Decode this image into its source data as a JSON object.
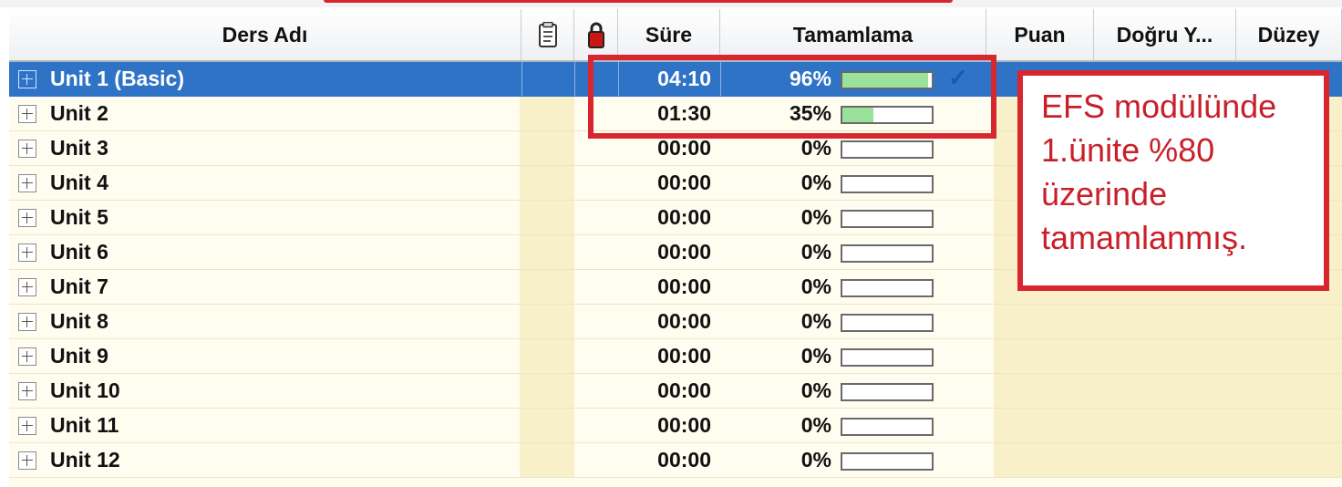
{
  "header": {
    "lesson_name": "Ders Adı",
    "notes_icon": "clipboard-icon",
    "lock_icon": "lock-icon",
    "duration": "Süre",
    "completion": "Tamamlama",
    "score": "Puan",
    "correct": "Doğru Y...",
    "level": "Düzey"
  },
  "rows": [
    {
      "name": "Unit 1 (Basic)",
      "time": "04:10",
      "percent": "96%",
      "progress": 0.96,
      "completed": true
    },
    {
      "name": "Unit 2",
      "time": "01:30",
      "percent": "35%",
      "progress": 0.35,
      "completed": false
    },
    {
      "name": "Unit 3",
      "time": "00:00",
      "percent": "0%",
      "progress": 0,
      "completed": false
    },
    {
      "name": "Unit 4",
      "time": "00:00",
      "percent": "0%",
      "progress": 0,
      "completed": false
    },
    {
      "name": "Unit 5",
      "time": "00:00",
      "percent": "0%",
      "progress": 0,
      "completed": false
    },
    {
      "name": "Unit 6",
      "time": "00:00",
      "percent": "0%",
      "progress": 0,
      "completed": false
    },
    {
      "name": "Unit 7",
      "time": "00:00",
      "percent": "0%",
      "progress": 0,
      "completed": false
    },
    {
      "name": "Unit 8",
      "time": "00:00",
      "percent": "0%",
      "progress": 0,
      "completed": false
    },
    {
      "name": "Unit 9",
      "time": "00:00",
      "percent": "0%",
      "progress": 0,
      "completed": false
    },
    {
      "name": "Unit 10",
      "time": "00:00",
      "percent": "0%",
      "progress": 0,
      "completed": false
    },
    {
      "name": "Unit 11",
      "time": "00:00",
      "percent": "0%",
      "progress": 0,
      "completed": false
    },
    {
      "name": "Unit 12",
      "time": "00:00",
      "percent": "0%",
      "progress": 0,
      "completed": false
    }
  ],
  "check_mark": "✓",
  "annotation": {
    "lines": [
      "EFS modülünde",
      "1.ünite %80",
      "üzerinde",
      "tamamlanmış."
    ]
  },
  "colors": {
    "selection": "#2f73c7",
    "highlight_border": "#d8262f",
    "note_text": "#c8202a",
    "progress_fill": "#9ae19a",
    "row_background": "#fffdf0",
    "column_shade": "#f8f0c8"
  }
}
